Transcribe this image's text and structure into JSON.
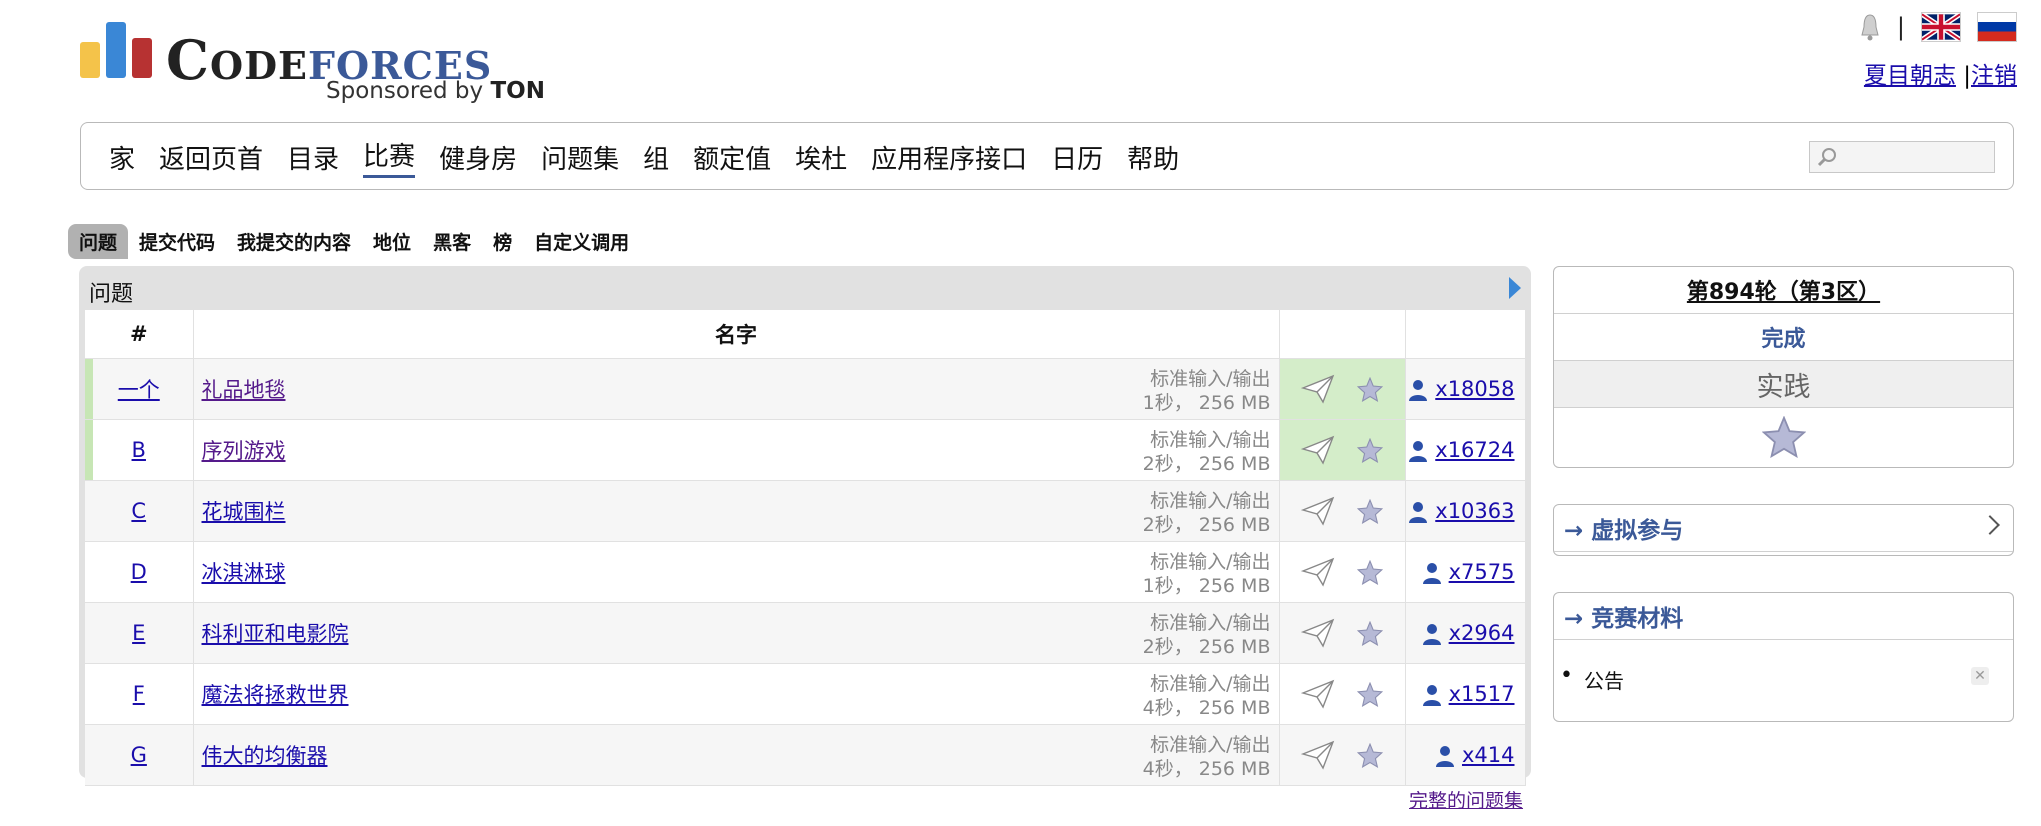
{
  "brand": {
    "name_part1": "Code",
    "name_part2": "forces",
    "sponsor_text": "Sponsored by",
    "sponsor_name": "TON",
    "bar_colors": [
      "#f4c34a",
      "#3a87d6",
      "#b73232"
    ]
  },
  "header": {
    "separator": "|",
    "user_name": "夏目朝志",
    "logout": "注销"
  },
  "main_nav": {
    "items": [
      {
        "label": "家"
      },
      {
        "label": "返回页首"
      },
      {
        "label": "目录"
      },
      {
        "label": "比赛",
        "active": true
      },
      {
        "label": "健身房"
      },
      {
        "label": "问题集"
      },
      {
        "label": "组"
      },
      {
        "label": "额定值"
      },
      {
        "label": "埃杜"
      },
      {
        "label": "应用程序接口"
      },
      {
        "label": "日历"
      },
      {
        "label": "帮助"
      }
    ],
    "search_placeholder": ""
  },
  "sub_nav": {
    "items": [
      {
        "label": "问题",
        "selected": true
      },
      {
        "label": "提交代码"
      },
      {
        "label": "我提交的内容"
      },
      {
        "label": "地位"
      },
      {
        "label": "黑客"
      },
      {
        "label": "榜"
      },
      {
        "label": "自定义调用"
      }
    ]
  },
  "problems": {
    "panel_title": "问题",
    "headers": {
      "index": "#",
      "name": "名字"
    },
    "rows": [
      {
        "index": "一个",
        "name": "礼品地毯",
        "io": "标准输入/输出",
        "limits": "1秒， 256 MB",
        "solved": "x18058",
        "accepted": true
      },
      {
        "index": "B",
        "name": "序列游戏",
        "io": "标准输入/输出",
        "limits": "2秒， 256 MB",
        "solved": "x16724",
        "accepted": true
      },
      {
        "index": "C",
        "name": "花城围栏",
        "io": "标准输入/输出",
        "limits": "2秒， 256 MB",
        "solved": "x10363",
        "accepted": false
      },
      {
        "index": "D",
        "name": "冰淇淋球",
        "io": "标准输入/输出",
        "limits": "1秒， 256 MB",
        "solved": "x7575",
        "accepted": false
      },
      {
        "index": "E",
        "name": "科利亚和电影院",
        "io": "标准输入/输出",
        "limits": "2秒， 256 MB",
        "solved": "x2964",
        "accepted": false
      },
      {
        "index": "F",
        "name": "魔法将拯救世界",
        "io": "标准输入/输出",
        "limits": "4秒， 256 MB",
        "solved": "x1517",
        "accepted": false
      },
      {
        "index": "G",
        "name": "伟大的均衡器",
        "io": "标准输入/输出",
        "limits": "4秒， 256 MB",
        "solved": "x414",
        "accepted": false
      }
    ],
    "complete_link": "完整的问题集"
  },
  "sidebar": {
    "contest_name": "第894轮（第3区）",
    "contest_status": "完成",
    "contest_phase": "实践",
    "virtual_title": "→ 虚拟参与",
    "materials_title": "→ 竞赛材料",
    "materials": [
      "公告"
    ]
  },
  "colors": {
    "accent": "#3b5998",
    "accepted_bg": "#d4edc9",
    "link": "#1a0dab",
    "visited": "#551a8b"
  }
}
